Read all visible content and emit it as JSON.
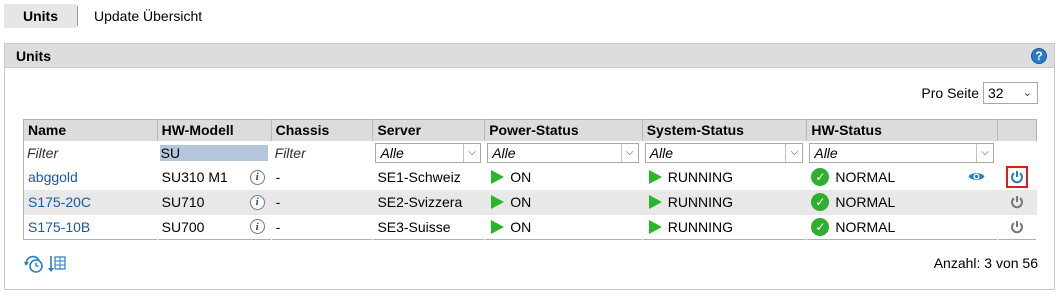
{
  "tabs": [
    {
      "label": "Units",
      "active": true
    },
    {
      "label": "Update Übersicht",
      "active": false
    }
  ],
  "panel": {
    "title": "Units",
    "help_label": "?"
  },
  "pagination": {
    "per_page_label": "Pro Seite",
    "per_page_value": "32",
    "count_label": "Anzahl: 3 von 56"
  },
  "table": {
    "headers": [
      "Name",
      "HW-Modell",
      "Chassis",
      "Server",
      "Power-Status",
      "System-Status",
      "HW-Status",
      ""
    ],
    "filters": {
      "name": "Filter",
      "hw_model": "SU",
      "chassis": "Filter",
      "server": "Alle",
      "power": "Alle",
      "system": "Alle",
      "hw": "Alle"
    },
    "rows": [
      {
        "name": "abggold",
        "hw_model": "SU310 M1",
        "chassis": "-",
        "server": "SE1-Schweiz",
        "power": "ON",
        "system": "RUNNING",
        "hw": "NORMAL"
      },
      {
        "name": "S175-20C",
        "hw_model": "SU710",
        "chassis": "-",
        "server": "SE2-Svizzera",
        "power": "ON",
        "system": "RUNNING",
        "hw": "NORMAL"
      },
      {
        "name": "S175-10B",
        "hw_model": "SU700",
        "chassis": "-",
        "server": "SE3-Suisse",
        "power": "ON",
        "system": "RUNNING",
        "hw": "NORMAL"
      }
    ]
  },
  "icons": {
    "info": "info-icon",
    "play": "play-icon",
    "ok": "check-circle-icon",
    "eye": "eye-icon",
    "power": "power-icon",
    "refresh_clock": "refresh-clock-icon",
    "export": "table-export-icon"
  },
  "colors": {
    "link": "#1a5aa0",
    "status_green": "#2fae2f",
    "accent_blue": "#2b7cc7",
    "highlight_red": "#e01b1b"
  }
}
